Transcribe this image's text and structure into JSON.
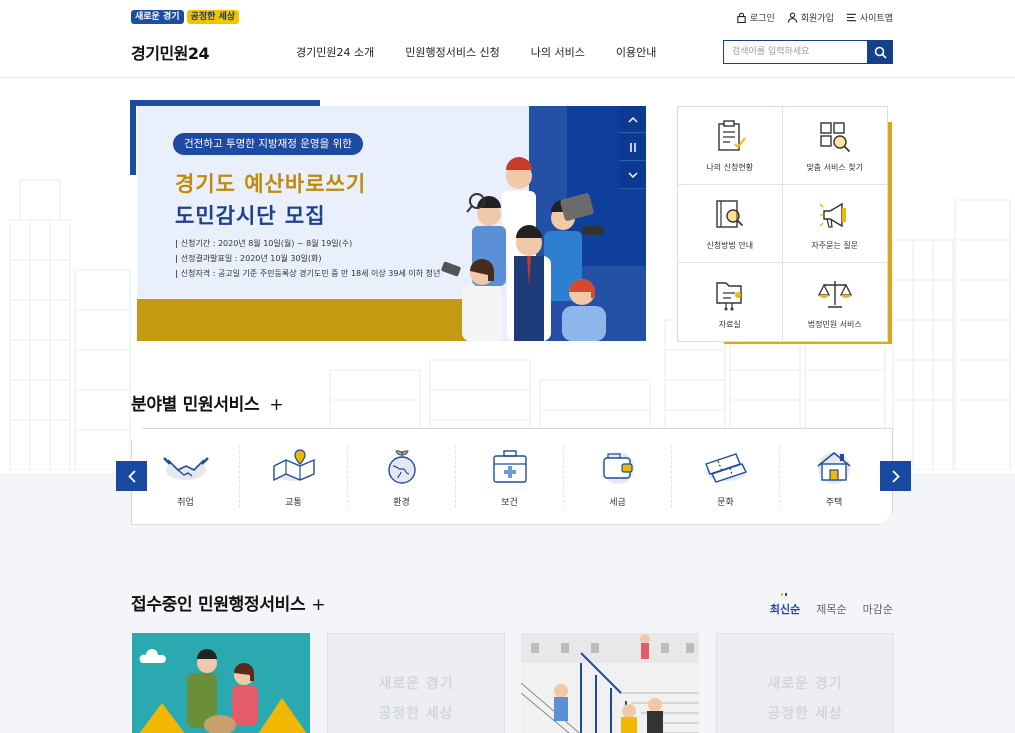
{
  "header": {
    "slogan": [
      "새로운 경기",
      "공정한 세상"
    ],
    "logo": "경기민원24",
    "utils": [
      {
        "icon": "lock-icon",
        "label": "로그인"
      },
      {
        "icon": "person-icon",
        "label": "회원가입"
      },
      {
        "icon": "menu-icon",
        "label": "사이트맵"
      }
    ],
    "nav": [
      "경기민원24 소개",
      "민원행정서비스 신청",
      "나의 서비스",
      "이용안내"
    ],
    "search_placeholder": "검색어를 입력하세요"
  },
  "banner": {
    "pill": "건전하고 투명한 지방재정 운영을 위한",
    "title1": "경기도 예산바로쓰기",
    "title2": "도민감시단 모집",
    "info": [
      "신청기간 : 2020년 8월 10일(월) ~ 8월 19일(수)",
      "선정결과발표일 : 2020년 10월 30일(화)",
      "신청자격 : 공고일 기준 주민등록상 경기도민 중 만 18세 이상 39세 이하 청년"
    ],
    "controls": [
      "up",
      "pause",
      "down"
    ]
  },
  "quick_menu": [
    {
      "label": "나의 신청현황",
      "icon": "clipboard-check-icon"
    },
    {
      "label": "맞춤 서비스 찾기",
      "icon": "grid-search-icon"
    },
    {
      "label": "신청방법 안내",
      "icon": "book-search-icon"
    },
    {
      "label": "자주묻는 질문",
      "icon": "megaphone-icon"
    },
    {
      "label": "자료실",
      "icon": "folder-network-icon"
    },
    {
      "label": "법정민원 서비스",
      "icon": "scale-icon"
    }
  ],
  "field_services": {
    "title": "분야별 민원서비스",
    "plus": "+",
    "items": [
      {
        "label": "취업",
        "icon": "handshake-icon"
      },
      {
        "label": "교통",
        "icon": "map-icon"
      },
      {
        "label": "환경",
        "icon": "globe-plant-icon"
      },
      {
        "label": "보건",
        "icon": "medical-kit-icon"
      },
      {
        "label": "세금",
        "icon": "wallet-icon"
      },
      {
        "label": "문화",
        "icon": "ticket-icon"
      },
      {
        "label": "주택",
        "icon": "house-icon"
      }
    ]
  },
  "receiving": {
    "title": "접수중인 민원행정서비스",
    "plus": "+",
    "sort": [
      "최신순",
      "제목순",
      "마감순"
    ],
    "active_sort": 0,
    "placeholder_text": [
      "새로운 경기",
      "공정한 세상"
    ]
  },
  "colors": {
    "primary": "#1a4a9f",
    "gold": "#c49a12",
    "yellow": "#f2b800"
  }
}
